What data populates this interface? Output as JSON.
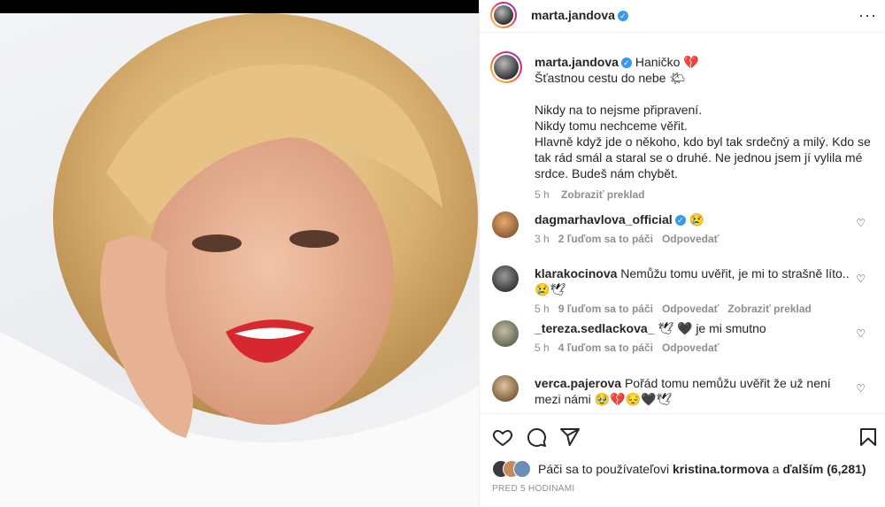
{
  "post": {
    "author": "marta.jandova",
    "caption_lines": [
      "Haničko 💔",
      "Šťastnou cestu do nebe 🌤",
      "",
      "Nikdy na to nejsme připravení.",
      "Nikdy tomu nechceme věřit.",
      "Hlavně když jde o někoho, kdo byl tak srdečný a milý. Kdo se tak rád smál a staral se o druhé. Ne jednou jsem jí vylila mé srdce. Budeš nám chybět."
    ],
    "time": "5 h",
    "translate_label": "Zobraziť preklad"
  },
  "comments": [
    {
      "user": "dagmarhavlova_official",
      "verified": "✓",
      "text": "😢",
      "time": "3 h",
      "likes": "2 ľuďom sa to páči",
      "reply": "Odpovedať",
      "translate": ""
    },
    {
      "user": "klarakocinova",
      "verified": "",
      "text": "Nemůžu tomu uvěřit, je mi to strašně líto..😢🕊",
      "time": "5 h",
      "likes": "9 ľuďom sa to páči",
      "reply": "Odpovedať",
      "translate": "Zobraziť preklad"
    },
    {
      "user": "_tereza.sedlackova_",
      "verified": "",
      "text": "🕊 🖤 je mi smutno",
      "time": "5 h",
      "likes": "4 ľuďom sa to páči",
      "reply": "Odpovedať",
      "translate": ""
    },
    {
      "user": "verca.pajerova",
      "verified": "",
      "text": "Pořád tomu nemůžu uvěřit že už není mezi námi 🥹💔😔🖤🕊",
      "time": "",
      "likes": "",
      "reply": "",
      "translate": ""
    }
  ],
  "likes_line": {
    "prefix": "Páči sa to používateľovi",
    "user": "kristina.tormova",
    "mid": "a",
    "others": "ďalším (6,281)"
  },
  "posted_ago": "PRED 5 HODINAMI",
  "icons": {
    "more": "more-icon",
    "like": "heart-icon",
    "comment": "comment-icon",
    "share": "share-icon",
    "save": "bookmark-icon"
  }
}
